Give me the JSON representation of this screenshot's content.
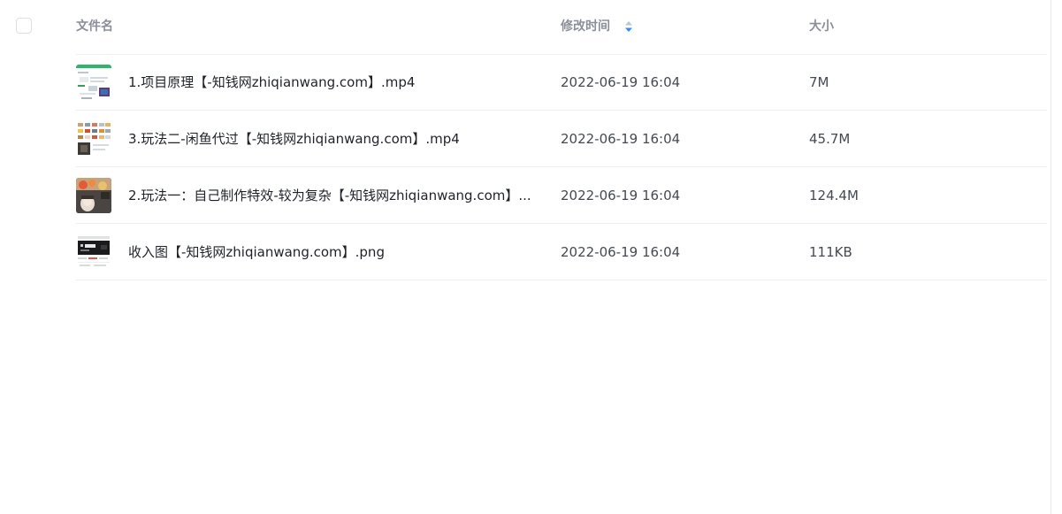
{
  "header": {
    "name_label": "文件名",
    "time_label": "修改时间",
    "size_label": "大小"
  },
  "colors": {
    "sort_active": "#2f8cf6",
    "sort_inactive": "#c0c4cc",
    "header_text": "#8a8f99",
    "divider": "#f0f0f0"
  },
  "files": [
    {
      "name": "1.项目原理【-知钱网zhiqianwang.com】.mp4",
      "modified": "2022-06-19 16:04",
      "size": "7M",
      "thumbnail": "video-thumbnail-webpage"
    },
    {
      "name": "3.玩法二-闲鱼代过【-知钱网zhiqianwang.com】.mp4",
      "modified": "2022-06-19 16:04",
      "size": "45.7M",
      "thumbnail": "video-thumbnail-product-grid"
    },
    {
      "name": "2.玩法一：自己制作特效-较为复杂【-知钱网zhiqianwang.com】....",
      "modified": "2022-06-19 16:04",
      "size": "124.4M",
      "thumbnail": "video-thumbnail-person"
    },
    {
      "name": "收入图【-知钱网zhiqianwang.com】.png",
      "modified": "2022-06-19 16:04",
      "size": "111KB",
      "thumbnail": "image-thumbnail-income"
    }
  ]
}
